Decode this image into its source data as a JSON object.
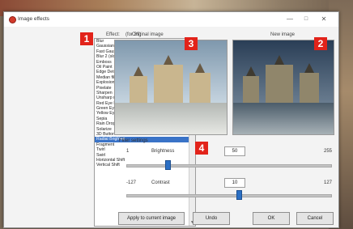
{
  "window": {
    "title": "Image effects",
    "min_icon": "—",
    "max_icon": "□",
    "close_icon": "✕"
  },
  "headers": {
    "effect": "Effect:",
    "count": "(for 39)",
    "original": "Original image",
    "new": "New image"
  },
  "badges": [
    "1",
    "2",
    "3",
    "4"
  ],
  "effects_list": [
    "Blur",
    "Gaussian Blur",
    "Fast Gaussian Blur",
    "Blur 2 (slow variation method)",
    "Emboss",
    "Oil Paint",
    "Edge Detection (Nation edge)",
    "Median filter (Noise removal)",
    "Explosion",
    "Pixelate",
    "Sharpen",
    "Unsharp mask",
    "Red Eye Reduction",
    "Green Eye Reduction",
    "Yellow Eye Reduction",
    "Sepia",
    "Rain Drop",
    "Solarize",
    "3D Button",
    "Radial Brighten",
    "Fragment",
    "Twirl",
    "Swirl",
    "Horizontal Shift",
    "Vertical Shift"
  ],
  "selected_effect": "Radial Brighten",
  "filter": {
    "title": "Filter settings",
    "brightness": {
      "min": "1",
      "label": "Brightness",
      "value": "50",
      "max": "255",
      "level": 0.19
    },
    "contrast": {
      "min": "-127",
      "label": "Contrast",
      "value": "10",
      "max": "127",
      "level": 0.54
    }
  },
  "buttons": {
    "apply": "Apply to current image",
    "undo": "Undo",
    "ok": "OK",
    "cancel": "Cancel"
  },
  "icons": {
    "app": "image-effects-app-icon",
    "scroll_up": "▲",
    "scroll_down": "▼"
  },
  "colors": {
    "badge": "#e2231a",
    "selection": "#3a73c7",
    "slider_thumb": "#2b6fc4"
  }
}
